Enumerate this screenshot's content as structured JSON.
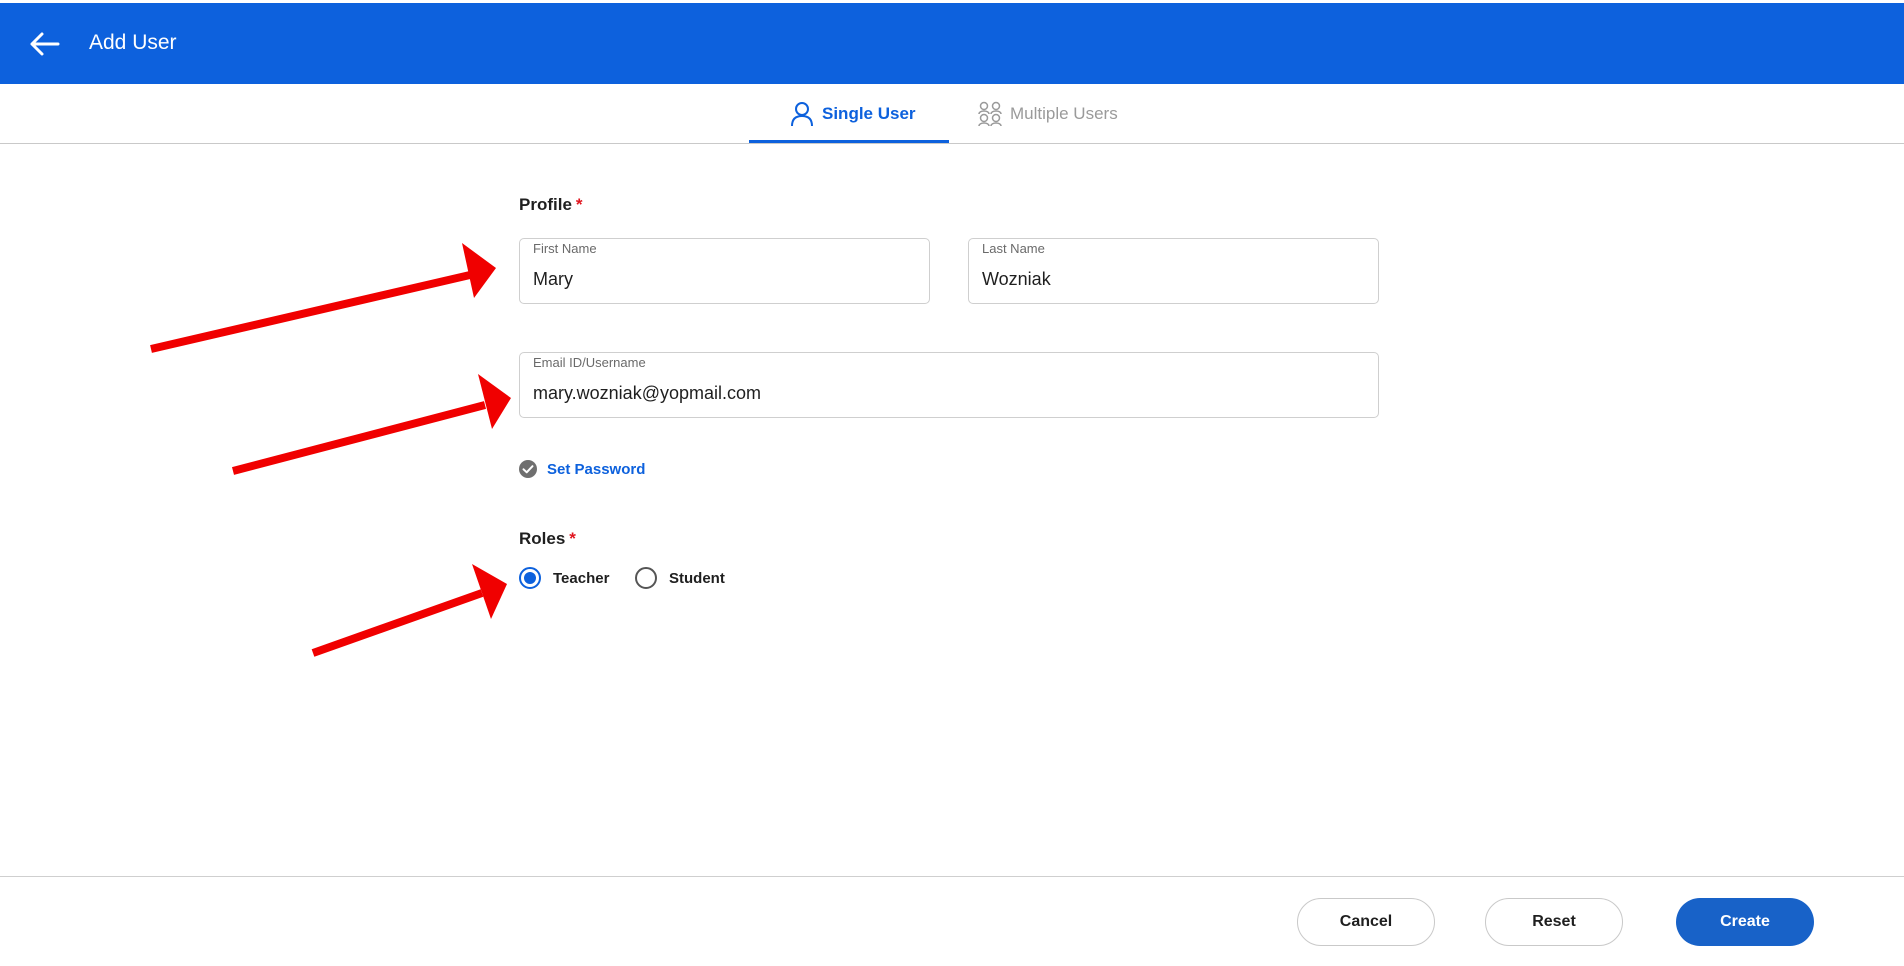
{
  "header": {
    "title": "Add User",
    "back_icon": "arrow-left-icon",
    "color": "#0d61dd"
  },
  "tabs": [
    {
      "label": "Single User",
      "icon": "user-icon",
      "active": true
    },
    {
      "label": "Multiple Users",
      "icon": "users-icon",
      "active": false
    }
  ],
  "profile": {
    "label": "Profile",
    "required_mark": "*",
    "first_name": {
      "label": "First Name",
      "value": "Mary"
    },
    "last_name": {
      "label": "Last Name",
      "value": "Wozniak"
    },
    "email": {
      "label": "Email ID/Username",
      "value": "mary.wozniak@yopmail.com"
    }
  },
  "set_password": {
    "label": "Set Password",
    "icon": "check-circle-icon"
  },
  "roles": {
    "label": "Roles",
    "required_mark": "*",
    "options": [
      {
        "label": "Teacher",
        "selected": true
      },
      {
        "label": "Student",
        "selected": false
      }
    ]
  },
  "footer": {
    "cancel": "Cancel",
    "reset": "Reset",
    "create": "Create"
  },
  "colors": {
    "accent": "#0d61dd",
    "required": "#e0141e",
    "arrow": "#f00000"
  }
}
